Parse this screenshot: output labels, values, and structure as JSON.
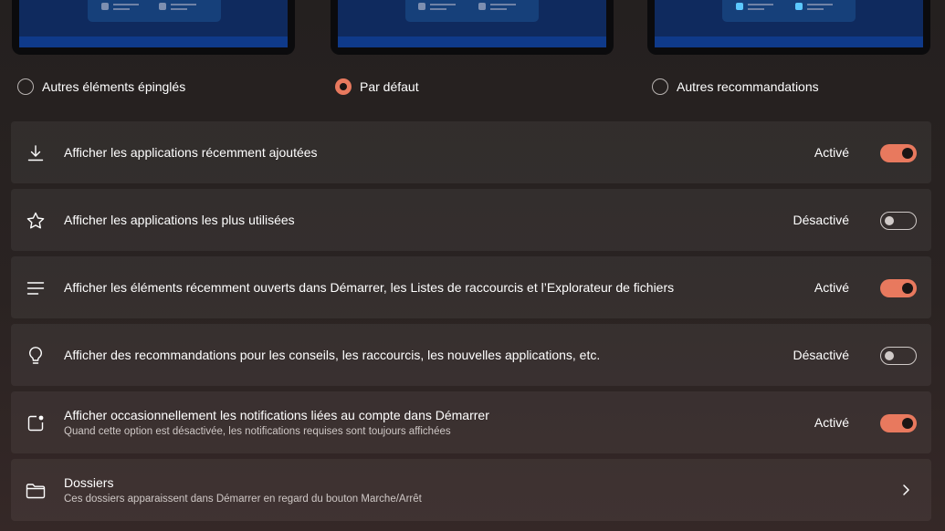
{
  "layouts": [
    {
      "label": "Autres éléments épinglés",
      "selected": false
    },
    {
      "label": "Par défaut",
      "selected": true
    },
    {
      "label": "Autres recommandations",
      "selected": false
    }
  ],
  "settings": [
    {
      "icon": "download-icon",
      "title": "Afficher les applications récemment ajoutées",
      "state": "Activé",
      "on": true
    },
    {
      "icon": "star-icon",
      "title": "Afficher les applications les plus utilisées",
      "state": "Désactivé",
      "on": false
    },
    {
      "icon": "list-icon",
      "title": "Afficher les éléments récemment ouverts dans Démarrer, les Listes de raccourcis et l’Explorateur de fichiers",
      "state": "Activé",
      "on": true
    },
    {
      "icon": "lightbulb-icon",
      "title": "Afficher des recommandations pour les conseils, les raccourcis, les nouvelles applications, etc.",
      "state": "Désactivé",
      "on": false
    },
    {
      "icon": "notification-badge-icon",
      "title": "Afficher occasionnellement les notifications liées au compte dans Démarrer",
      "subtitle": "Quand cette option est désactivée, les notifications requises sont toujours affichées",
      "state": "Activé",
      "on": true
    }
  ],
  "folders": {
    "icon": "folder-icon",
    "title": "Dossiers",
    "subtitle": "Ces dossiers apparaissent dans Démarrer en regard du bouton Marche/Arrêt"
  },
  "colors": {
    "accent": "#e8795e",
    "card": "#2f2a29"
  }
}
